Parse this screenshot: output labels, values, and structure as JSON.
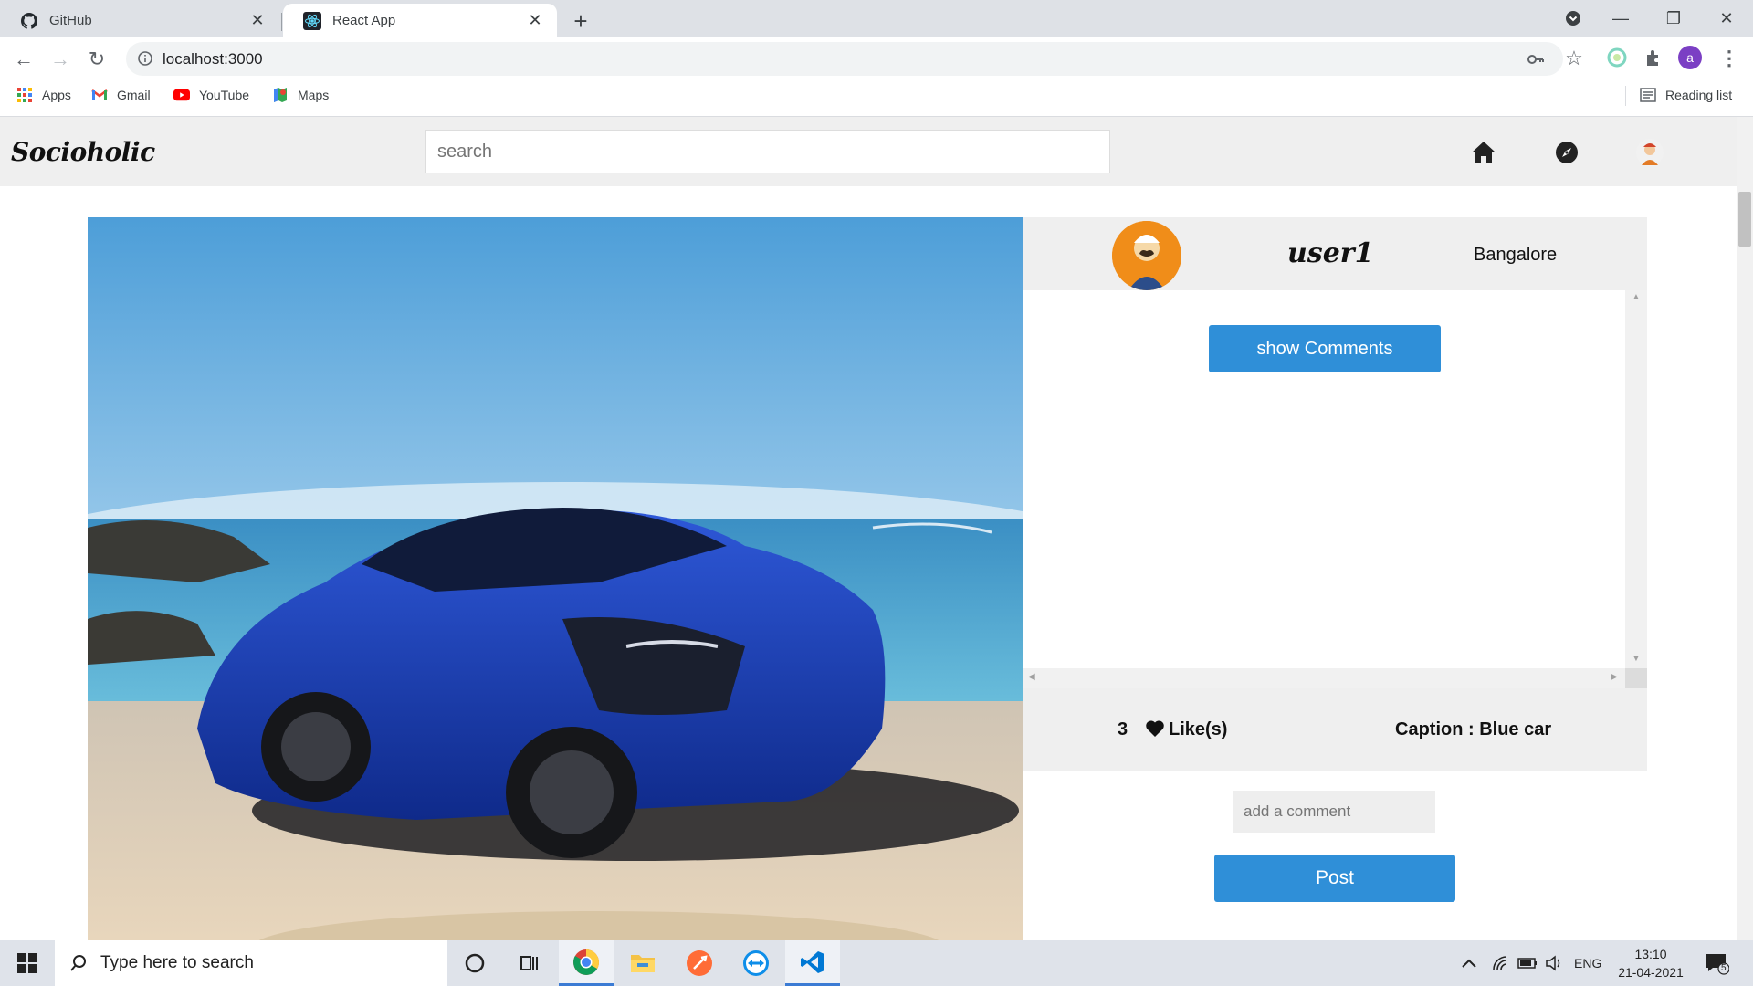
{
  "browser": {
    "tabs": [
      {
        "title": "GitHub",
        "icon": "github-icon"
      },
      {
        "title": "React App",
        "icon": "react-icon",
        "active": true
      }
    ],
    "url": "localhost:3000",
    "bookmarks": [
      {
        "label": "Apps",
        "icon": "apps-grid-icon"
      },
      {
        "label": "Gmail",
        "icon": "gmail-icon"
      },
      {
        "label": "YouTube",
        "icon": "youtube-icon"
      },
      {
        "label": "Maps",
        "icon": "maps-icon"
      }
    ],
    "reading_list": "Reading list",
    "profile_initial": "a"
  },
  "app": {
    "logo": "Socioholic",
    "search_placeholder": "search",
    "nav_icons": [
      "home-icon",
      "explore-compass-icon",
      "profile-avatar-icon"
    ]
  },
  "post": {
    "image_alt": "Blue car on beach",
    "username": "user1",
    "location": "Bangalore",
    "show_comments_label": "show Comments",
    "likes_count": "3",
    "likes_label": "Like(s)",
    "caption": "Caption : Blue car",
    "comment_placeholder": "add a comment",
    "post_label": "Post"
  },
  "taskbar": {
    "search_placeholder": "Type here to search",
    "language": "ENG",
    "time": "13:10",
    "date": "21-04-2021",
    "notification_count": "5"
  },
  "colors": {
    "accent_button": "#2f8fd8",
    "header_bg": "#efefef"
  }
}
